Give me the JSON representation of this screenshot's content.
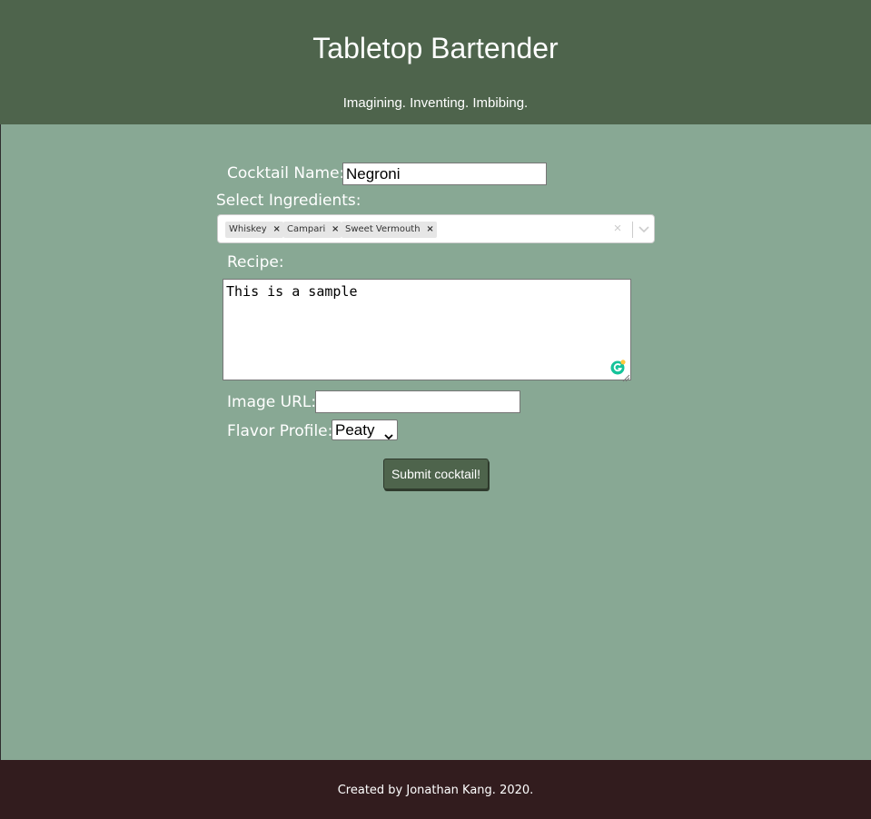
{
  "header": {
    "title": "Tabletop Bartender",
    "tagline": "Imagining. Inventing. Imbibing."
  },
  "form": {
    "cocktail_name_label": "Cocktail Name:",
    "cocktail_name_value": "Negroni",
    "ingredients_label": "Select Ingredients:",
    "ingredients_selected": [
      "Whiskey",
      "Campari",
      "Sweet Vermouth"
    ],
    "remove_glyph": "×",
    "clear_glyph": "×",
    "recipe_label": "Recipe:",
    "recipe_value": "This is a sample",
    "image_url_label": "Image URL:",
    "image_url_value": "",
    "flavor_profile_label": "Flavor Profile:",
    "flavor_profile_value": "Peaty",
    "submit_label": "Submit cocktail!"
  },
  "footer": {
    "text": "Created by Jonathan Kang. 2020."
  },
  "colors": {
    "header_bg": "#4e644c",
    "page_bg": "#88a894",
    "footer_bg": "#321c1e",
    "button_bg": "#4e644c",
    "grammarly": "#15c39a"
  },
  "icons": {
    "chip_remove": "close-icon",
    "clear_all": "clear-icon",
    "dropdown": "chevron-down-icon",
    "grammarly": "grammarly-icon",
    "resize": "resize-grip-icon"
  }
}
